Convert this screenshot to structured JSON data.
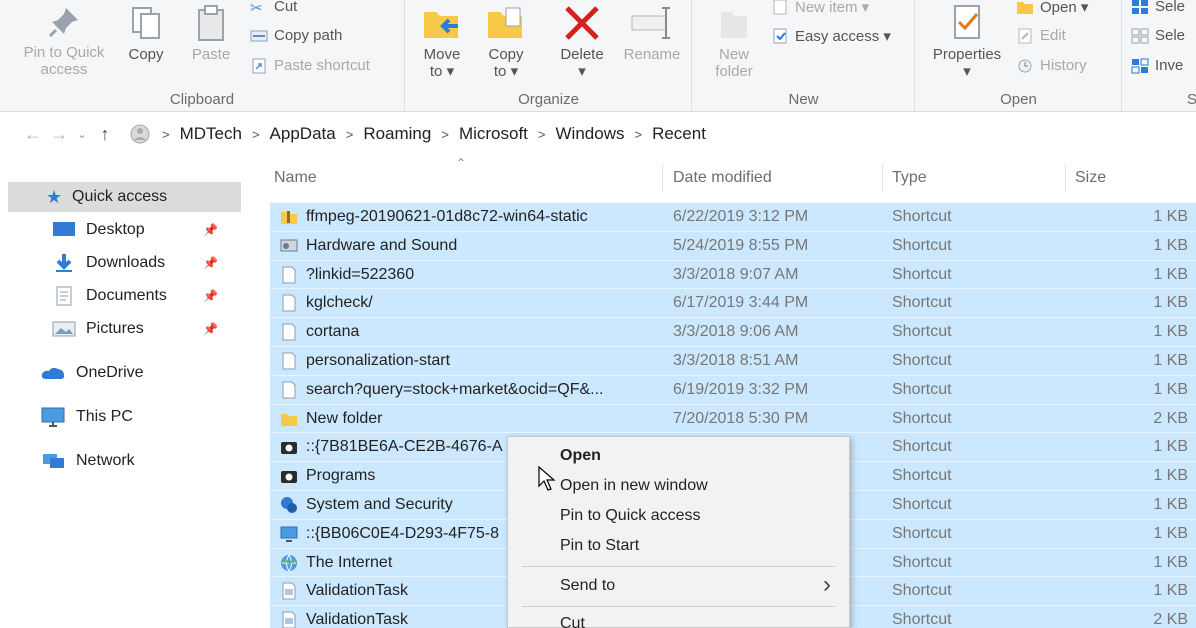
{
  "ribbon": {
    "clipboard": {
      "label": "Clipboard",
      "pin_label": "Pin to Quick\naccess",
      "copy_label": "Copy",
      "paste_label": "Paste",
      "cut_label": "Cut",
      "copy_path_label": "Copy path",
      "paste_shortcut_label": "Paste shortcut"
    },
    "organize": {
      "label": "Organize",
      "move_to_label": "Move\nto ▾",
      "copy_to_label": "Copy\nto ▾",
      "delete_label": "Delete\n▾",
      "rename_label": "Rename"
    },
    "new": {
      "label": "New",
      "new_folder_label": "New\nfolder",
      "new_item_label": "New item ▾",
      "easy_access_label": "Easy access ▾"
    },
    "open": {
      "label": "Open",
      "properties_label": "Properties\n▾",
      "open_label": "Open ▾",
      "edit_label": "Edit",
      "history_label": "History"
    },
    "select": {
      "label": "S",
      "select_all_label": "Sele",
      "select_none_label": "Sele",
      "invert_label": "Inve"
    }
  },
  "address": {
    "crumbs": [
      "MDTech",
      "AppData",
      "Roaming",
      "Microsoft",
      "Windows",
      "Recent"
    ]
  },
  "nav": {
    "quick_access": "Quick access",
    "desktop": "Desktop",
    "downloads": "Downloads",
    "documents": "Documents",
    "pictures": "Pictures",
    "onedrive": "OneDrive",
    "this_pc": "This PC",
    "network": "Network"
  },
  "columns": {
    "name": "Name",
    "date": "Date modified",
    "type": "Type",
    "size": "Size"
  },
  "files": [
    {
      "name": "ffmpeg-20190621-01d8c72-win64-static",
      "date": "6/22/2019 3:12 PM",
      "type": "Shortcut",
      "size": "1 KB",
      "icon": "zip-folder-icon"
    },
    {
      "name": "Hardware and Sound",
      "date": "5/24/2019 8:55 PM",
      "type": "Shortcut",
      "size": "1 KB",
      "icon": "control-panel-icon"
    },
    {
      "name": "?linkid=522360",
      "date": "3/3/2018 9:07 AM",
      "type": "Shortcut",
      "size": "1 KB",
      "icon": "file-icon"
    },
    {
      "name": "kglcheck/",
      "date": "6/17/2019 3:44 PM",
      "type": "Shortcut",
      "size": "1 KB",
      "icon": "file-icon"
    },
    {
      "name": "cortana",
      "date": "3/3/2018 9:06 AM",
      "type": "Shortcut",
      "size": "1 KB",
      "icon": "file-icon"
    },
    {
      "name": "personalization-start",
      "date": "3/3/2018 8:51 AM",
      "type": "Shortcut",
      "size": "1 KB",
      "icon": "file-icon"
    },
    {
      "name": "search?query=stock+market&ocid=QF&...",
      "date": "6/19/2019 3:32 PM",
      "type": "Shortcut",
      "size": "1 KB",
      "icon": "file-icon"
    },
    {
      "name": "New folder",
      "date": "7/20/2018 5:30 PM",
      "type": "Shortcut",
      "size": "2 KB",
      "icon": "folder-icon"
    },
    {
      "name": "::{7B81BE6A-CE2B-4676-A",
      "date": "",
      "type": "Shortcut",
      "size": "1 KB",
      "icon": "camera-icon"
    },
    {
      "name": "Programs",
      "date": "",
      "type": "Shortcut",
      "size": "1 KB",
      "icon": "camera-icon"
    },
    {
      "name": "System and Security",
      "date": "",
      "type": "Shortcut",
      "size": "1 KB",
      "icon": "security-icon"
    },
    {
      "name": "::{BB06C0E4-D293-4F75-8",
      "date": "",
      "type": "Shortcut",
      "size": "1 KB",
      "icon": "monitor-icon"
    },
    {
      "name": "The Internet",
      "date": "",
      "type": "Shortcut",
      "size": "1 KB",
      "icon": "globe-icon"
    },
    {
      "name": "ValidationTask",
      "date": "",
      "type": "Shortcut",
      "size": "1 KB",
      "icon": "doc-icon"
    },
    {
      "name": "ValidationTask",
      "date": "",
      "type": "Shortcut",
      "size": "2 KB",
      "icon": "doc-icon"
    }
  ],
  "context_menu": {
    "open": "Open",
    "open_new_window": "Open in new window",
    "pin_quick_access": "Pin to Quick access",
    "pin_start": "Pin to Start",
    "send_to": "Send to",
    "send_to_arrow": "›",
    "cut": "Cut"
  },
  "colors": {
    "selection": "#cce8ff",
    "ribbon_bg": "#f5f6f7",
    "delete_red": "#d81e1e",
    "folder_yellow": "#f7c948"
  }
}
